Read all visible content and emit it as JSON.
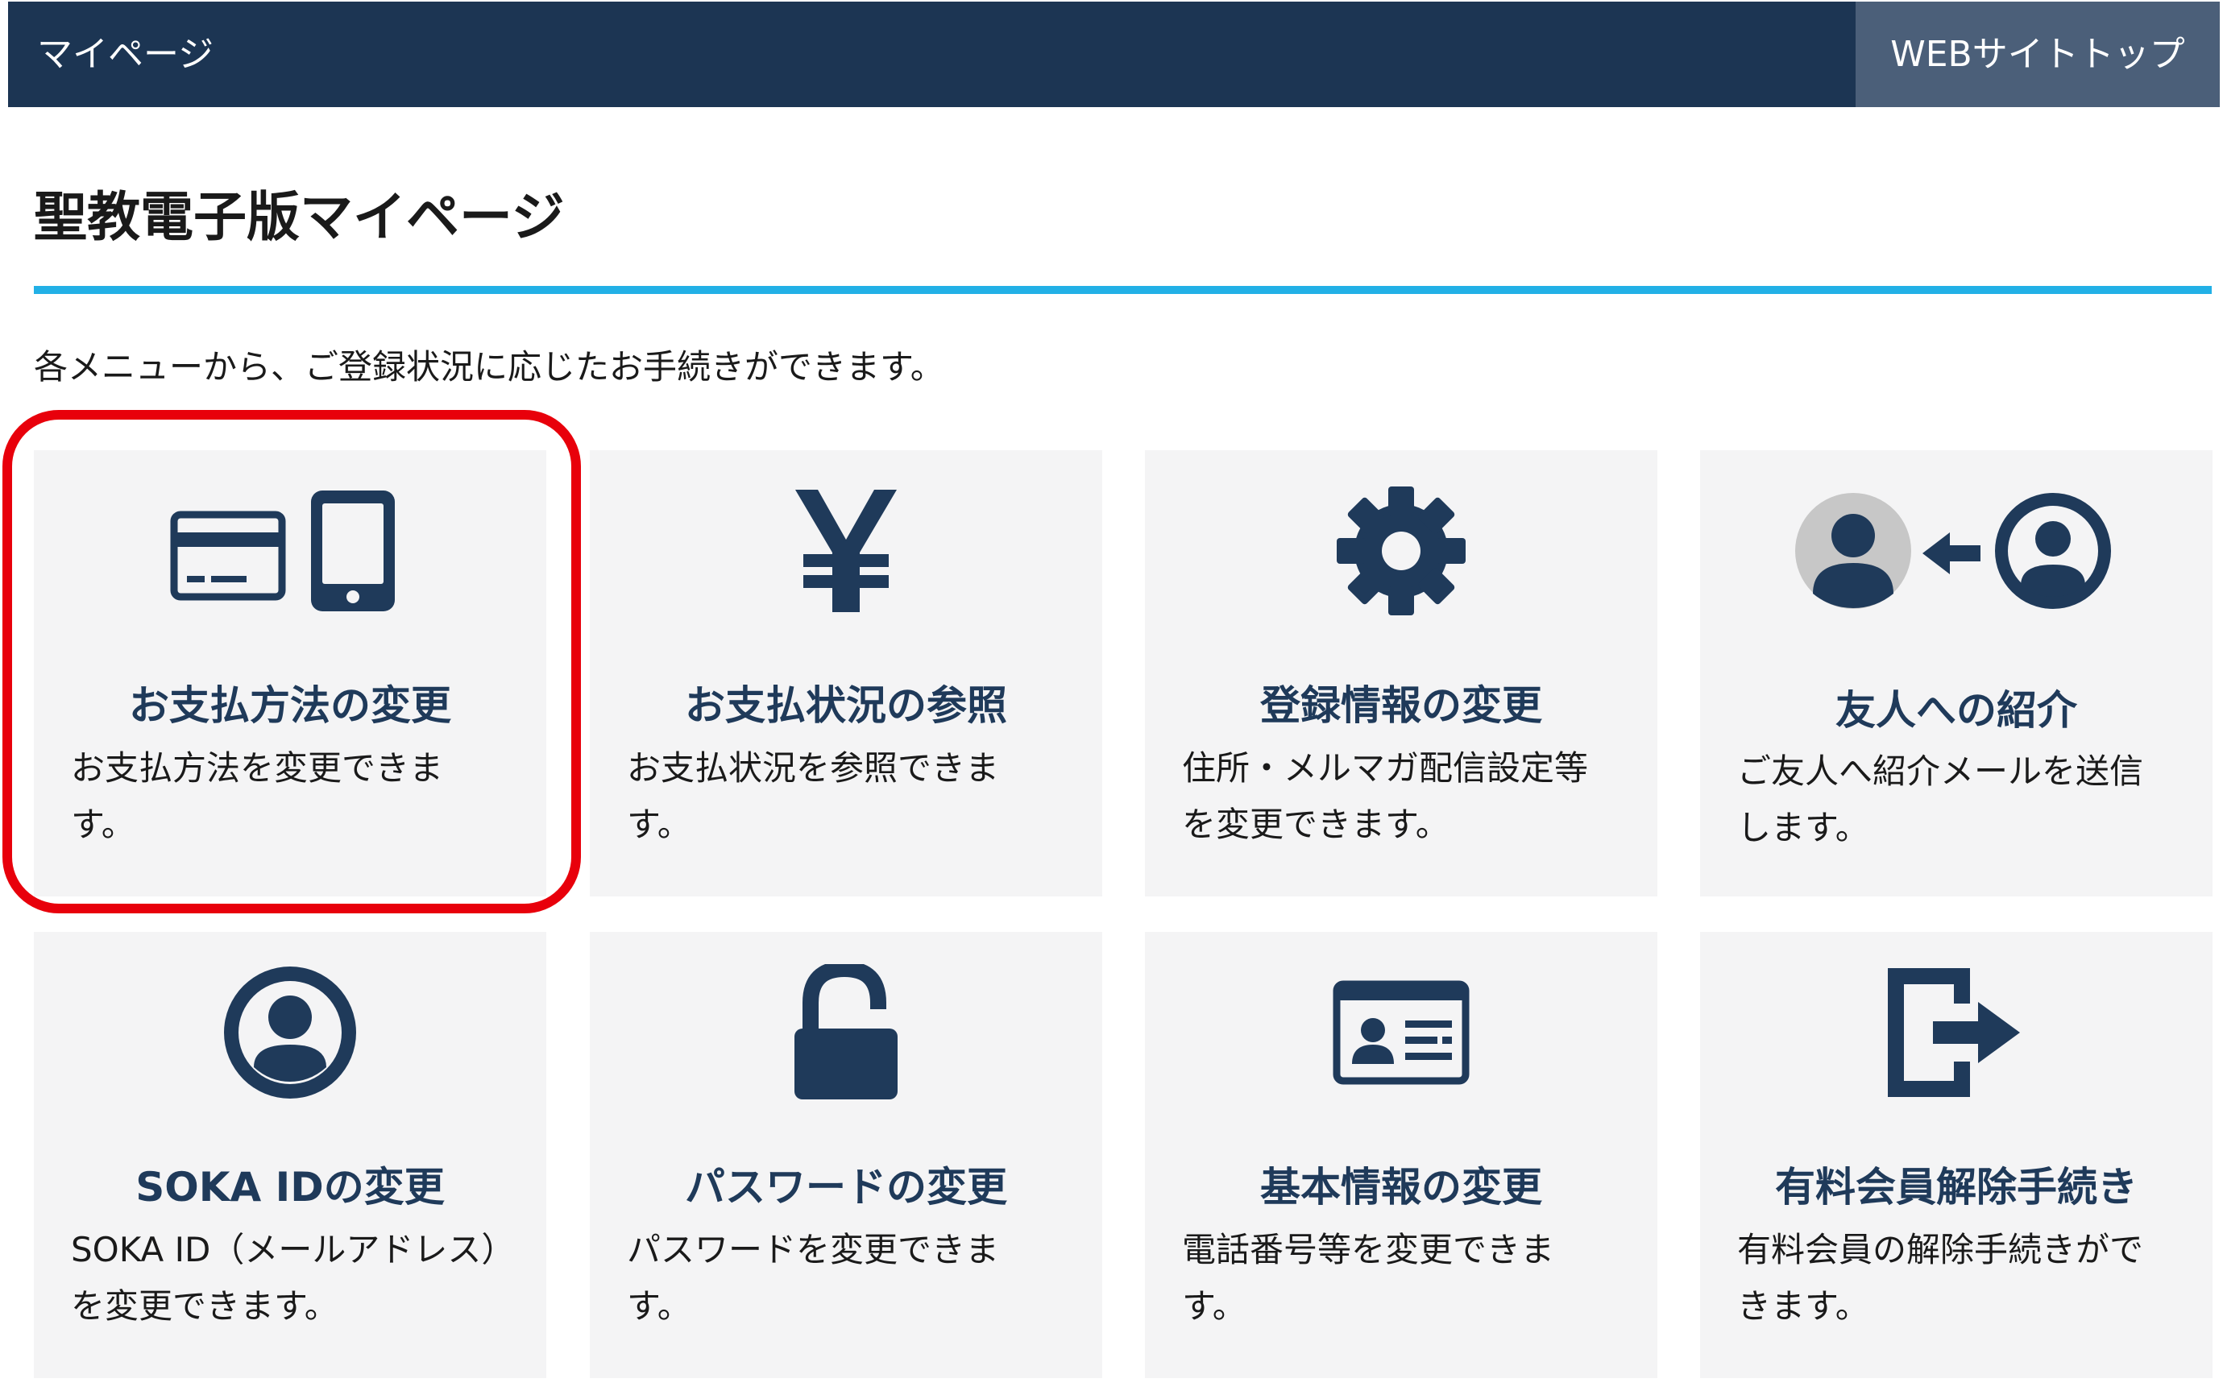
{
  "header": {
    "title": "マイページ",
    "site_top_label": "WEBサイトトップ"
  },
  "page": {
    "title": "聖教電子版マイページ",
    "intro": "各メニューから、ご登録状況に応じたお手続きができます。"
  },
  "colors": {
    "header_bg": "#1c3553",
    "accent_rule": "#22b0e6",
    "icon_navy": "#1f3a5a",
    "highlight_red": "#e8000b"
  },
  "cards": [
    {
      "icon": "credit-card-and-phone-icon",
      "label": "お支払方法の変更",
      "desc": "お支払方法を変更できます。"
    },
    {
      "icon": "yen-icon",
      "label": "お支払状況の参照",
      "desc": "お支払状況を参照できます。"
    },
    {
      "icon": "gear-icon",
      "label": "登録情報の変更",
      "desc": "住所・メルマガ配信設定等を変更できます。"
    },
    {
      "icon": "friend-referral-icon",
      "label": "友人への紹介",
      "desc": "ご友人へ紹介メールを送信します。"
    },
    {
      "icon": "user-circle-icon",
      "label": "SOKA IDの変更",
      "desc": "SOKA ID（メールアドレス）を変更できます。"
    },
    {
      "icon": "unlocked-padlock-icon",
      "label": "パスワードの変更",
      "desc": "パスワードを変更できます。"
    },
    {
      "icon": "id-card-icon",
      "label": "基本情報の変更",
      "desc": "電話番号等を変更できます。"
    },
    {
      "icon": "exit-door-icon",
      "label": "有料会員解除手続き",
      "desc": "有料会員の解除手続きができます。"
    }
  ]
}
